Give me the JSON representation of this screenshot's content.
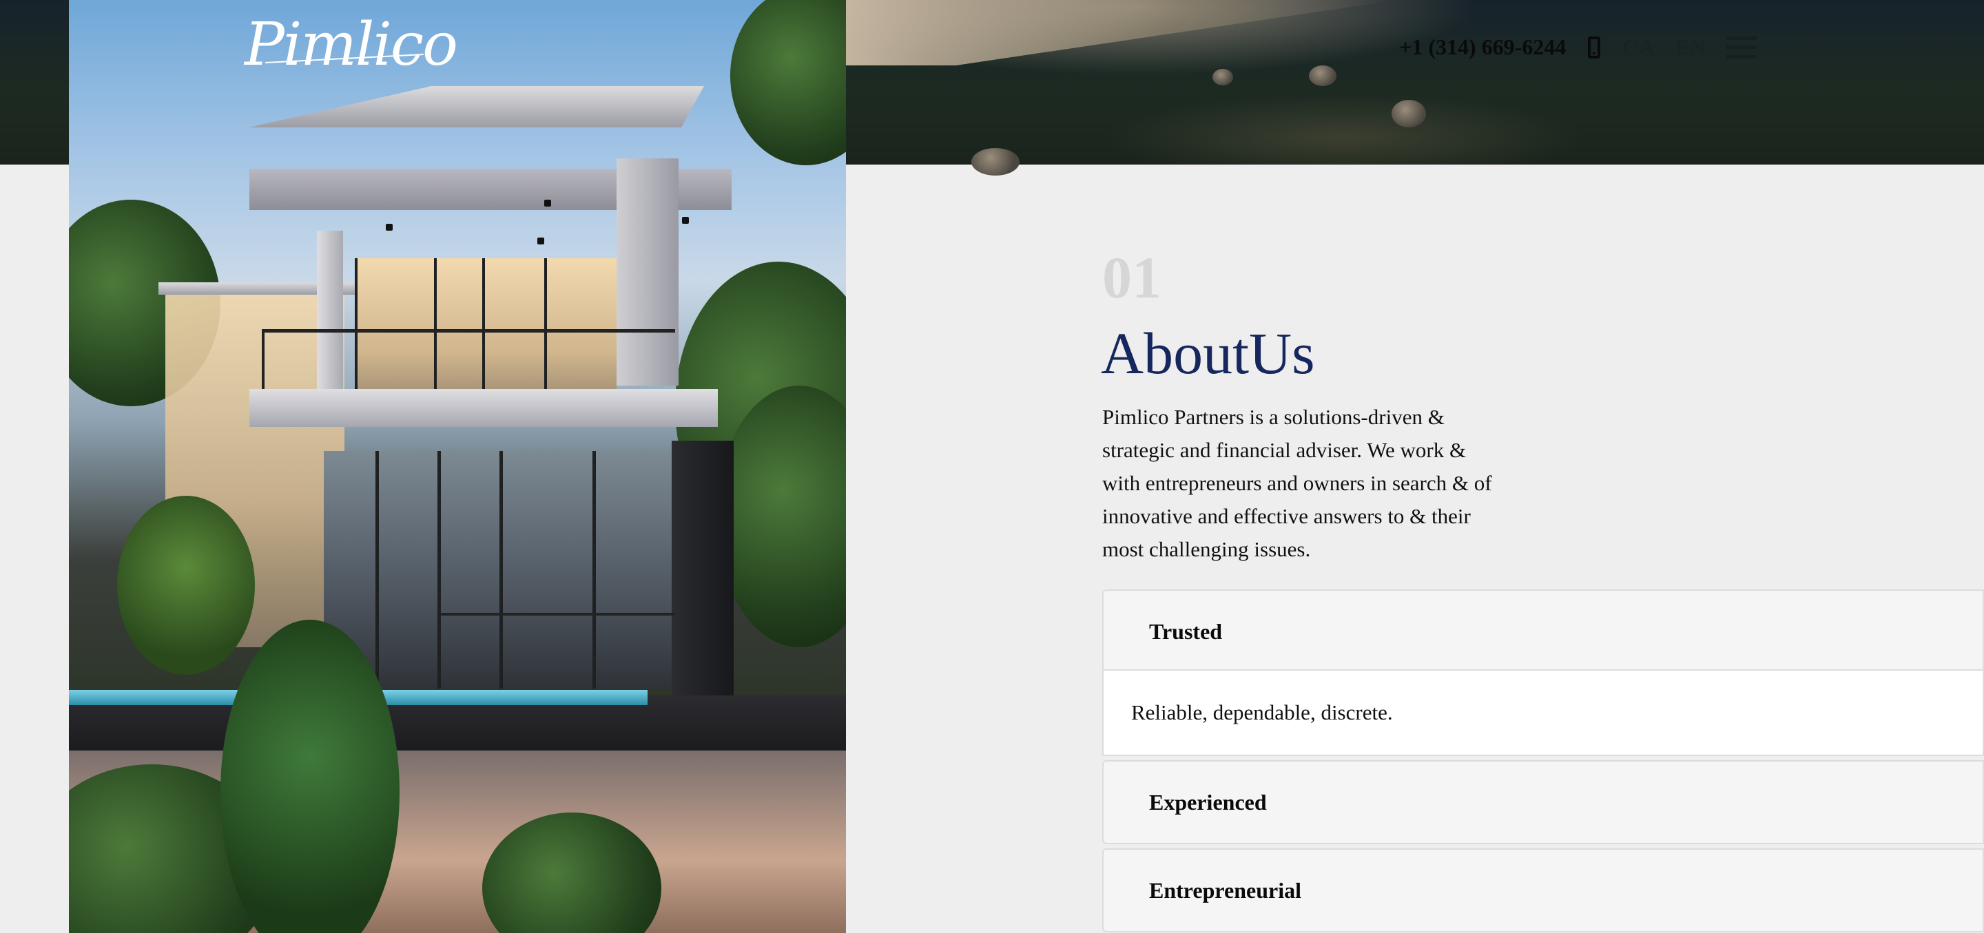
{
  "brand": {
    "logo_text": "Pimlico"
  },
  "header": {
    "phone": "+1 (314) 669-6244",
    "languages": [
      "CA",
      "EN"
    ]
  },
  "about": {
    "number": "01",
    "title": "AboutUs",
    "intro": "Pimlico Partners is a solutions-driven & strategic and financial adviser. We work & with entrepreneurs and owners in search & of innovative and effective answers to & their most challenging issues."
  },
  "accordion": [
    {
      "title": "Trusted",
      "body": "Reliable, dependable, discrete.",
      "expanded": true
    },
    {
      "title": "Experienced",
      "expanded": false
    },
    {
      "title": "Entrepreneurial",
      "expanded": false
    }
  ],
  "icons": {
    "phone": "mobile-phone-icon",
    "menu": "hamburger-menu-icon"
  },
  "colors": {
    "title": "#16275d",
    "section_number": "#d6d6d6",
    "page_background": "#eeeeee"
  }
}
